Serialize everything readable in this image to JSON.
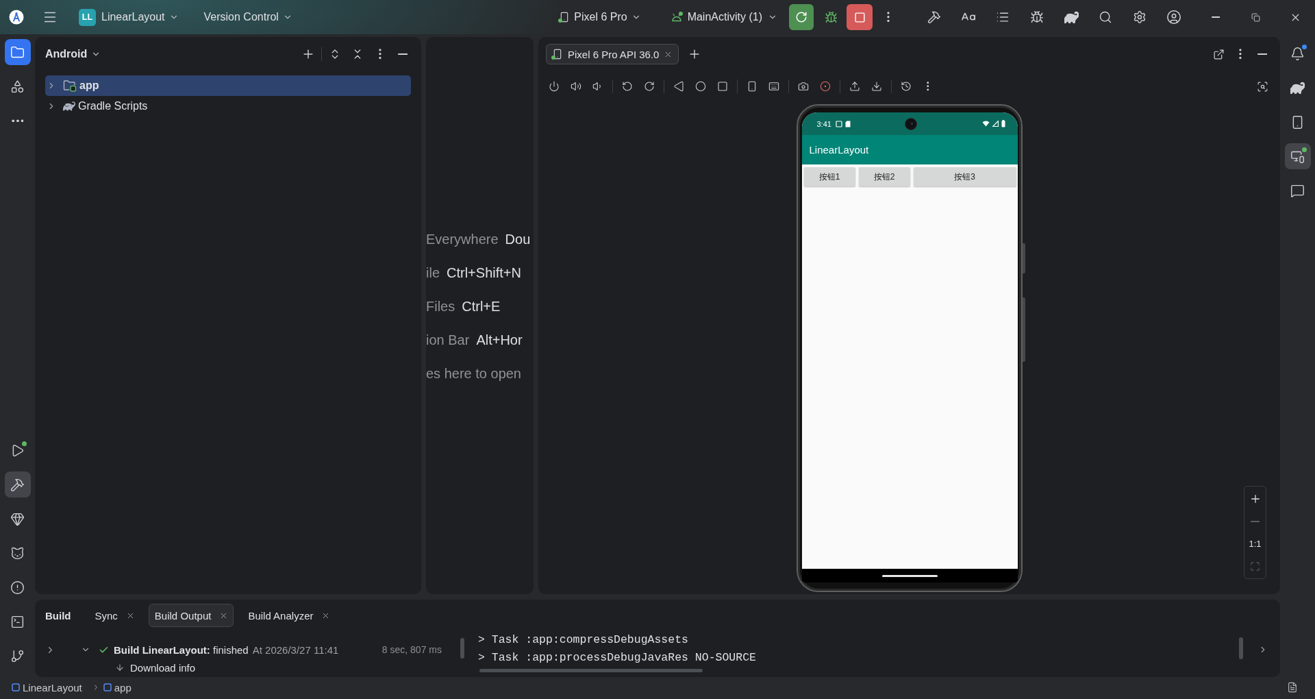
{
  "title_bar": {
    "project_badge": "LL",
    "project_name": "LinearLayout",
    "vcs": "Version Control",
    "device": {
      "label": "Pixel 6 Pro",
      "running": true
    },
    "run_config": {
      "label": "MainActivity (1)",
      "running": true
    }
  },
  "left_toolbar": {
    "top": [
      {
        "selected": true
      },
      {
        "selected": false
      },
      {
        "selected": false
      }
    ],
    "bottom": [
      {
        "selected": false,
        "badge": true,
        "color": "#5fb865"
      },
      {
        "selected": true,
        "badge": false
      },
      {
        "selected": false,
        "badge": false
      },
      {
        "selected": false,
        "badge": false
      },
      {
        "selected": false,
        "badge": false
      },
      {
        "selected": false,
        "badge": false
      },
      {
        "selected": false,
        "badge": false
      }
    ]
  },
  "project_panel": {
    "view": "Android",
    "tree": [
      {
        "kind": "module",
        "label": "app",
        "selected": true,
        "expanded": false
      },
      {
        "kind": "scripts",
        "label": "Gradle Scripts",
        "selected": false,
        "expanded": false
      }
    ]
  },
  "editor_hints": [
    {
      "action": "Everywhere",
      "shortcut": "Dou"
    },
    {
      "action": "ile",
      "shortcut": "Ctrl+Shift+N"
    },
    {
      "action": "Files",
      "shortcut": "Ctrl+E"
    },
    {
      "action": "ion Bar",
      "shortcut": "Alt+Hor"
    },
    {
      "action": "es here to open"
    }
  ],
  "running_devices": {
    "tabs": [
      {
        "label": "Pixel 6 Pro API 36.0",
        "selected": true,
        "running": true
      }
    ],
    "device": {
      "time": "3:41",
      "app_title": "LinearLayout",
      "buttons": [
        "按钮1",
        "按钮2",
        "按钮3"
      ]
    },
    "zoom_controls": [
      {
        "kind": "zoom-in",
        "disabled": false
      },
      {
        "kind": "zoom-out",
        "disabled": true
      },
      {
        "kind": "actual-size",
        "label": "1:1",
        "disabled": false
      },
      {
        "kind": "fit",
        "disabled": true
      }
    ]
  },
  "build_window": {
    "title": "Build",
    "tabs": [
      {
        "label": "Sync",
        "selected": false
      },
      {
        "label": "Build Output",
        "selected": true
      },
      {
        "label": "Build Analyzer",
        "selected": false
      }
    ],
    "tree": [
      {
        "label": "**Build LinearLayout:** finished",
        "time": "At 2026/3/27 11:41",
        "duration": "8 sec, 807 ms",
        "success": true,
        "expanded": true,
        "children": [
          {
            "label": "Download info"
          }
        ]
      }
    ],
    "console": [
      "> Task :app:compressDebugAssets",
      "> Task :app:processDebugJavaRes NO-SOURCE"
    ]
  },
  "right_toolbar": [
    {
      "selected": false,
      "badge": true,
      "color": "#3d8af7"
    },
    {
      "selected": false,
      "badge": false
    },
    {
      "selected": false,
      "badge": false
    },
    {
      "selected": true,
      "badge": true,
      "color": "#5fb865"
    },
    {
      "selected": false,
      "badge": false
    }
  ],
  "status_bar": {
    "breadcrumbs": [
      "LinearLayout",
      "app"
    ]
  }
}
